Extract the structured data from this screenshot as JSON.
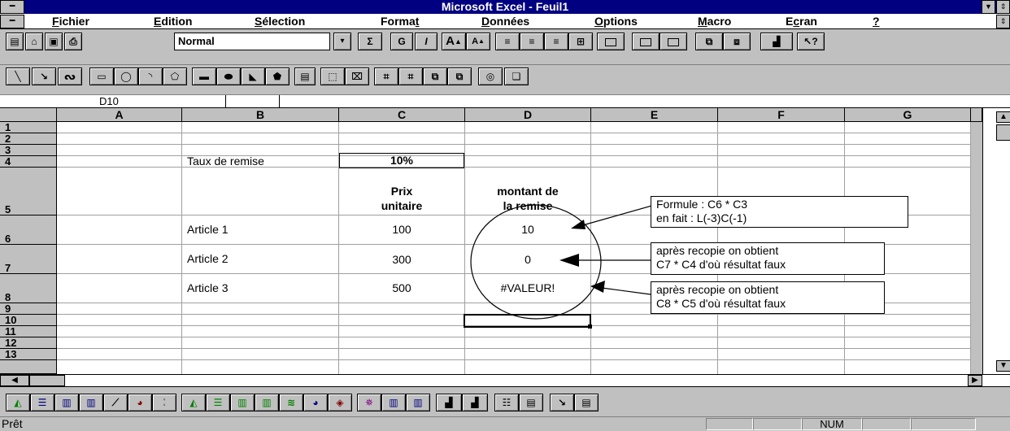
{
  "window": {
    "title": "Microsoft Excel - Feuil1"
  },
  "menu": [
    {
      "label": "Fichier",
      "key": "F",
      "rest": "ichier"
    },
    {
      "label": "Edition",
      "key": "E",
      "rest": "dition"
    },
    {
      "label": "Sélection",
      "key": "S",
      "rest": "élection"
    },
    {
      "label": "Format",
      "key": "t",
      "pre": "Forma"
    },
    {
      "label": "Données",
      "key": "D",
      "rest": "onnées"
    },
    {
      "label": "Options",
      "key": "O",
      "rest": "ptions"
    },
    {
      "label": "Macro",
      "key": "M",
      "rest": "acro"
    },
    {
      "label": "Ecran",
      "key": "c",
      "pre": "E",
      "rest": "ran"
    },
    {
      "label": "?",
      "key": "?"
    }
  ],
  "toolbar": {
    "style_value": "Normal",
    "sum": "Σ",
    "bold": "G",
    "italic": "I",
    "help": "?"
  },
  "formula_bar": {
    "name_box": "D10"
  },
  "columns": [
    "A",
    "B",
    "C",
    "D",
    "E",
    "F",
    "G"
  ],
  "rows": [
    "1",
    "2",
    "3",
    "4",
    "5",
    "6",
    "7",
    "8",
    "9",
    "10",
    "11",
    "12",
    "13"
  ],
  "cells": {
    "B3": "Taux de remise",
    "C3": "10%",
    "C5_line1": "Prix",
    "C5_line2": "unitaire",
    "D5_line1": "montant de",
    "D5_line2": "la remise",
    "B6": "Article 1",
    "C6": "100",
    "D6": "10",
    "B7": "Article 2",
    "C7": "300",
    "D7": "0",
    "B8": "Article 3",
    "C8": "500",
    "D8": "#VALEUR!"
  },
  "notes": {
    "n1_line1": "Formule : C6 * C3",
    "n1_line2": "en fait : L(-3)C(-1)",
    "n2_line1": "après recopie on obtient",
    "n2_line2": "C7 * C4  d'où résultat faux",
    "n3_line1": "après recopie on obtient",
    "n3_line2": "C8 * C5  d'où résultat faux"
  },
  "status": {
    "text": "Prêt",
    "num": "NUM"
  },
  "icons": [
    "system-menu-icon",
    "doc-menu-icon",
    "new-icon",
    "open-icon",
    "save-icon",
    "print-icon",
    "dropdown-arrow-icon",
    "sum-icon",
    "bold-icon",
    "italic-icon",
    "font-increase-icon",
    "font-decrease-icon",
    "align-left-icon",
    "align-center-icon",
    "align-right-icon",
    "center-across-icon",
    "border-icon",
    "help-icon",
    "line-tool-icon",
    "arrow-tool-icon",
    "freehand-icon",
    "rectangle-icon",
    "ellipse-icon",
    "arc-icon",
    "polygon-icon",
    "chart-icon",
    "scroll-up-icon",
    "scroll-down-icon",
    "scroll-left-icon",
    "scroll-right-icon"
  ]
}
